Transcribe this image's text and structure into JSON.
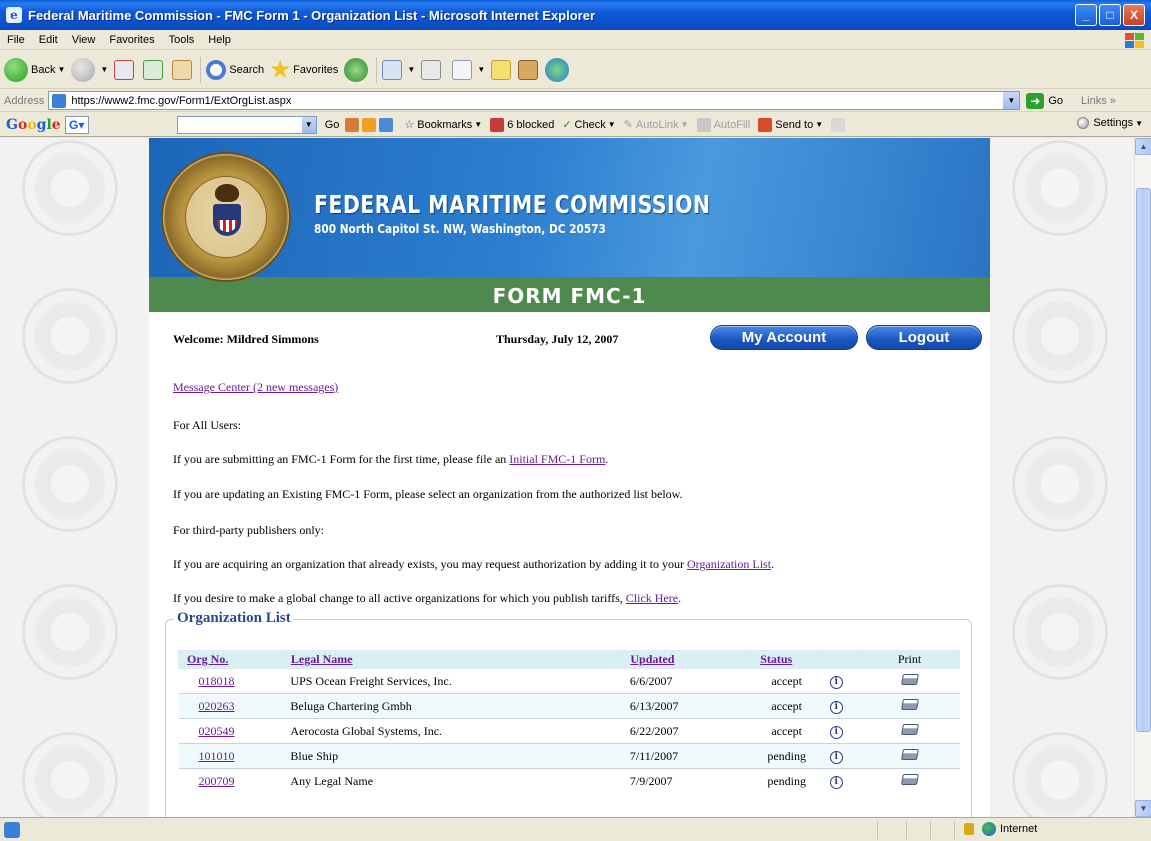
{
  "window": {
    "title": "Federal Maritime Commission - FMC Form 1 - Organization List - Microsoft Internet Explorer",
    "buttons": {
      "minimize": "_",
      "maximize": "□",
      "close": "X"
    }
  },
  "menu": [
    "File",
    "Edit",
    "View",
    "Favorites",
    "Tools",
    "Help"
  ],
  "toolbar": {
    "back": "Back",
    "search": "Search",
    "favorites": "Favorites"
  },
  "address": {
    "label": "Address",
    "url": "https://www2.fmc.gov/Form1/ExtOrgList.aspx",
    "go": "Go",
    "links": "Links"
  },
  "google_bar": {
    "logo": "Google",
    "go": "Go",
    "bookmarks": "Bookmarks",
    "blocked": "6 blocked",
    "check": "Check",
    "autolink": "AutoLink",
    "autofill": "AutoFill",
    "sendto": "Send to",
    "settings": "Settings"
  },
  "header": {
    "title": "FEDERAL MARITIME COMMISSION",
    "address": "800 North Capitol St. NW, Washington, DC 20573",
    "form_title": "FORM FMC-1"
  },
  "user_row": {
    "welcome": "Welcome: Mildred Simmons",
    "date": "Thursday, July 12, 2007",
    "my_account": "My Account",
    "logout": "Logout"
  },
  "content": {
    "message_center": "Message Center (2 new messages)",
    "for_all_users": "For All Users:",
    "first_time_pre": "If you are submitting an FMC-1 Form for the first time, please file an ",
    "first_time_link": "Initial FMC-1 Form",
    "first_time_post": ".",
    "updating": "If you are updating an Existing FMC-1 Form, please select an organization from the authorized list below.",
    "third_party": "For third-party publishers only:",
    "acquiring_pre": "If you are acquiring an organization that already exists, you may request authorization by adding it to your ",
    "acquiring_link": "Organization List",
    "acquiring_post": ".",
    "global_pre": "If you desire to make a global change to all active organizations for which you publish tariffs, ",
    "global_link": "Click Here",
    "global_post": "."
  },
  "org_list": {
    "legend": "Organization List",
    "columns": {
      "org_no": "Org No.",
      "legal_name": "Legal Name",
      "updated": "Updated",
      "status": "Status",
      "print": "Print"
    },
    "rows": [
      {
        "org_no": "018018",
        "legal_name": "UPS Ocean Freight Services, Inc.",
        "updated": "6/6/2007",
        "status": "accept"
      },
      {
        "org_no": "020263",
        "legal_name": "Beluga Chartering Gmbh",
        "updated": "6/13/2007",
        "status": "accept"
      },
      {
        "org_no": "020549",
        "legal_name": "Aerocosta Global Systems, Inc.",
        "updated": "6/22/2007",
        "status": "accept"
      },
      {
        "org_no": "101010",
        "legal_name": "Blue Ship",
        "updated": "7/11/2007",
        "status": "pending"
      },
      {
        "org_no": "200709",
        "legal_name": "Any Legal Name",
        "updated": "7/9/2007",
        "status": "pending"
      }
    ]
  },
  "statusbar": {
    "zone": "Internet"
  }
}
